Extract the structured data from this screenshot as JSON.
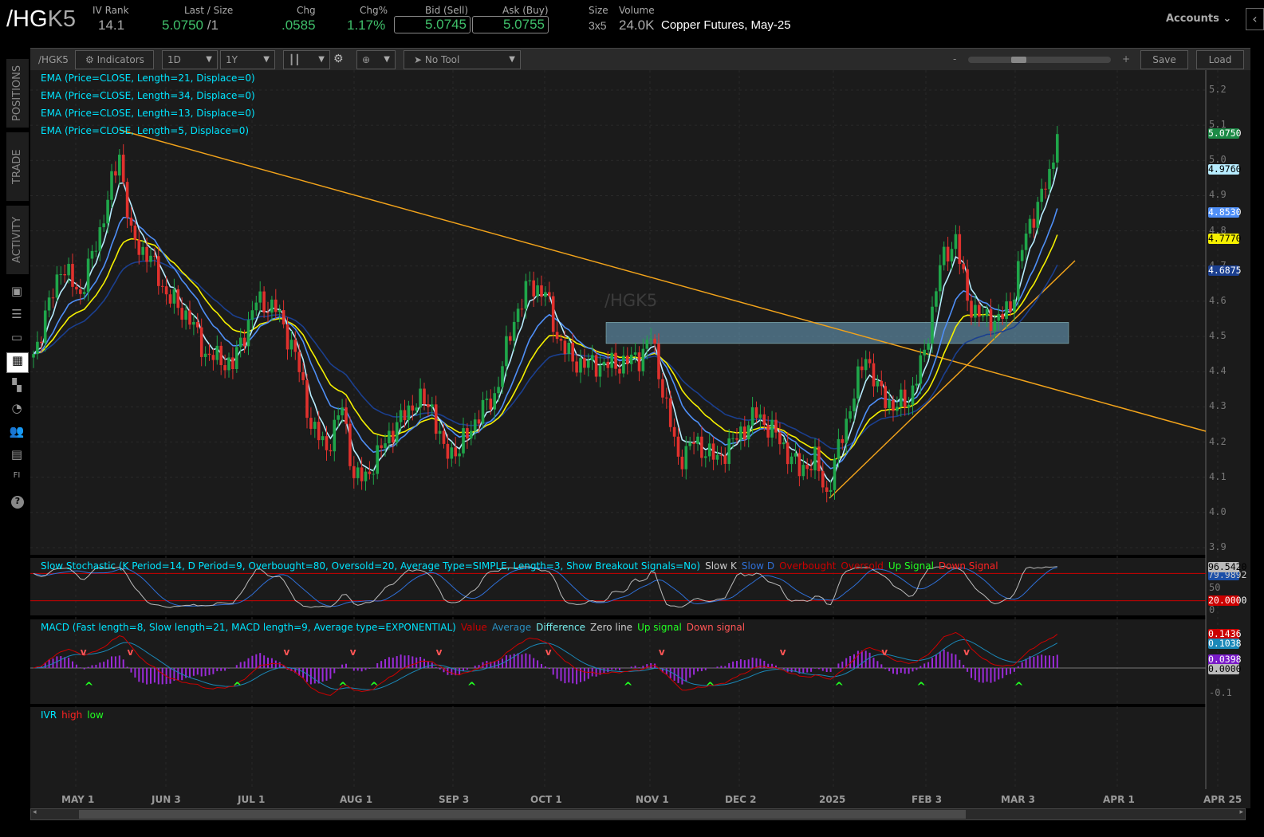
{
  "header": {
    "symbol_prefix": "/HG",
    "symbol_suffix": "K5",
    "iv_rank_label": "IV Rank",
    "iv_rank": "14.1",
    "last_label": "Last / Size",
    "last": "5.0750",
    "last_size": "/1",
    "chg_label": "Chg",
    "chg": ".0585",
    "chgpct_label": "Chg%",
    "chgpct": "1.17%",
    "bid_label": "Bid (Sell)",
    "bid": "5.0745",
    "ask_label": "Ask (Buy)",
    "ask": "5.0755",
    "size_label": "Size",
    "size": "3x5",
    "volume_label": "Volume",
    "volume": "24.0K",
    "description": "Copper Futures, May-25",
    "accounts": "Accounts"
  },
  "toolbar": {
    "symbol": "/HGK5",
    "indicators": "Indicators",
    "aggregation": "1D",
    "period": "1Y",
    "tool": "No Tool",
    "zoom_minus": "-",
    "zoom_plus": "+",
    "zoom_level": 0.3,
    "save": "Save",
    "load": "Load"
  },
  "sidebar": {
    "tabs": [
      "POSITIONS",
      "TRADE",
      "ACTIVITY"
    ]
  },
  "legend": {
    "ema": [
      "EMA (Price=CLOSE, Length=21, Displace=0)",
      "EMA (Price=CLOSE, Length=34, Displace=0)",
      "EMA (Price=CLOSE, Length=13, Displace=0)",
      "EMA (Price=CLOSE, Length=5, Displace=0)"
    ],
    "stoch": {
      "title": "Slow Stochastic (K Period=14, D Period=9, Overbought=80, Oversold=20, Average Type=SIMPLE, Length=3, Show Breakout Signals=No)",
      "items": [
        "Slow K",
        "Slow D",
        "Overbought",
        "Oversold",
        "Up Signal",
        "Down Signal"
      ]
    },
    "macd": {
      "title": "MACD (Fast length=8, Slow length=21, MACD length=9, Average type=EXPONENTIAL)",
      "items": [
        "Value",
        "Average",
        "Difference",
        "Zero line",
        "Up signal",
        "Down signal"
      ]
    },
    "ivr": {
      "title": "IVR",
      "items": [
        "high",
        "low"
      ]
    }
  },
  "watermark": "/HGK5",
  "colors": {
    "up": "#1fa64a",
    "down": "#e0312d",
    "ema5": "#b7ecff",
    "ema13": "#4f8ff7",
    "ema21": "#f5f000",
    "ema34": "#1b3f8f",
    "trend": "#f2a31b",
    "zone": "#6fa8c8"
  },
  "chart_data": {
    "type": "candlestick",
    "price_axis": [
      "5.2",
      "5.1",
      "5.0",
      "4.9",
      "4.8",
      "4.7",
      "4.6",
      "4.5",
      "4.4",
      "4.3",
      "4.2",
      "4.1",
      "4.0",
      "3.9"
    ],
    "ylim": [
      3.9,
      5.2
    ],
    "x_labels": [
      "MAY 1",
      "JUN 3",
      "JUL 1",
      "AUG 1",
      "SEP 3",
      "OCT 1",
      "NOV 1",
      "DEC 2",
      "2025",
      "FEB 3",
      "MAR 3",
      "APR 1",
      "APR 25"
    ],
    "close_anchors": [
      [
        0,
        4.45
      ],
      [
        1,
        4.48
      ],
      [
        7,
        4.7
      ],
      [
        12,
        4.62
      ],
      [
        17,
        4.8
      ],
      [
        22,
        5.02
      ],
      [
        25,
        4.78
      ],
      [
        30,
        4.72
      ],
      [
        34,
        4.62
      ],
      [
        40,
        4.55
      ],
      [
        44,
        4.45
      ],
      [
        51,
        4.42
      ],
      [
        57,
        4.6
      ],
      [
        62,
        4.58
      ],
      [
        67,
        4.45
      ],
      [
        71,
        4.25
      ],
      [
        75,
        4.18
      ],
      [
        79,
        4.3
      ],
      [
        82,
        4.1
      ],
      [
        85,
        4.1
      ],
      [
        91,
        4.22
      ],
      [
        98,
        4.32
      ],
      [
        102,
        4.3
      ],
      [
        105,
        4.17
      ],
      [
        109,
        4.18
      ],
      [
        114,
        4.28
      ],
      [
        118,
        4.33
      ],
      [
        123,
        4.55
      ],
      [
        127,
        4.65
      ],
      [
        131,
        4.62
      ],
      [
        134,
        4.5
      ],
      [
        138,
        4.43
      ],
      [
        142,
        4.42
      ],
      [
        149,
        4.42
      ],
      [
        155,
        4.44
      ],
      [
        158,
        4.5
      ],
      [
        161,
        4.35
      ],
      [
        165,
        4.15
      ],
      [
        169,
        4.2
      ],
      [
        175,
        4.15
      ],
      [
        179,
        4.2
      ],
      [
        185,
        4.28
      ],
      [
        190,
        4.22
      ],
      [
        196,
        4.12
      ],
      [
        200,
        4.15
      ],
      [
        203,
        4.05
      ],
      [
        206,
        4.18
      ],
      [
        209,
        4.3
      ],
      [
        213,
        4.45
      ],
      [
        216,
        4.35
      ],
      [
        220,
        4.3
      ],
      [
        224,
        4.32
      ],
      [
        228,
        4.45
      ],
      [
        232,
        4.7
      ],
      [
        236,
        4.78
      ],
      [
        239,
        4.6
      ],
      [
        243,
        4.55
      ],
      [
        247,
        4.55
      ],
      [
        250,
        4.58
      ],
      [
        253,
        4.75
      ],
      [
        257,
        4.88
      ],
      [
        260,
        4.95
      ],
      [
        262,
        5.075
      ]
    ],
    "emas": [
      5,
      13,
      21,
      34
    ],
    "last_values": {
      "last": "5.0750",
      "ema5": "4.9760",
      "ema13": "4.8530",
      "ema21": "4.7770",
      "ema34": "4.6875"
    },
    "stoch_axis": [
      "50",
      "0"
    ],
    "stoch_values": {
      "k": "96.5420",
      "d": "79.9892",
      "oversold": "20.0000"
    },
    "macd_axis": [
      "-0.1"
    ],
    "macd_values": {
      "value": "0.1436",
      "avg": "0.1038",
      "diff": "0.0398",
      "zero": "0.0000"
    },
    "support_zone": [
      4.48,
      4.54
    ]
  }
}
